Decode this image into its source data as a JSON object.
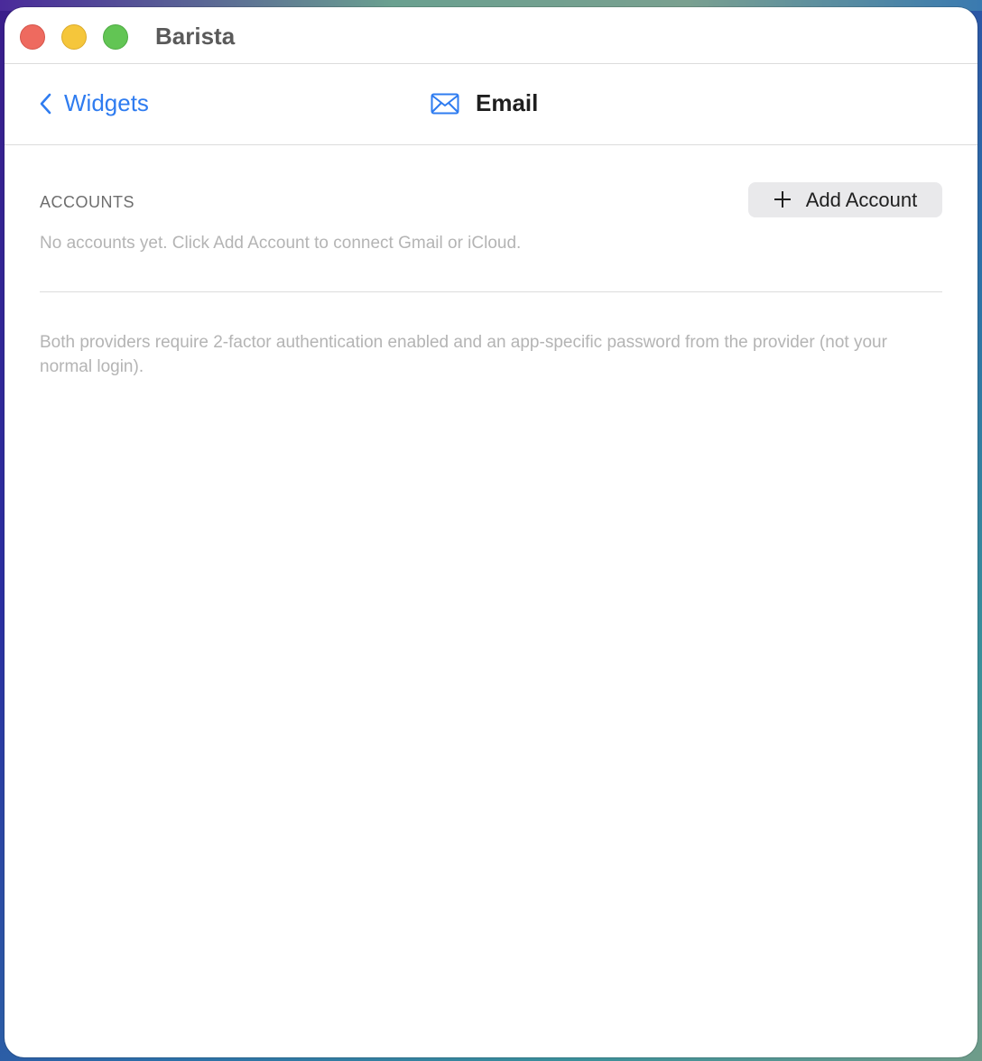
{
  "window": {
    "app_title": "Barista"
  },
  "navbar": {
    "back_label": "Widgets",
    "title": "Email",
    "title_icon": "envelope-icon"
  },
  "accounts": {
    "section_label": "ACCOUNTS",
    "add_button_label": "Add Account",
    "add_button_icon": "plus",
    "empty_text": "No accounts yet. Click Add Account to connect Gmail or iCloud."
  },
  "note": "Both providers require 2-factor authentication enabled and an app-specific password from the provider (not your normal login).",
  "colors": {
    "accent": "#2f7cf0",
    "close": "#ee6a5f",
    "minimize": "#f5c63b",
    "maximize": "#62c554"
  }
}
